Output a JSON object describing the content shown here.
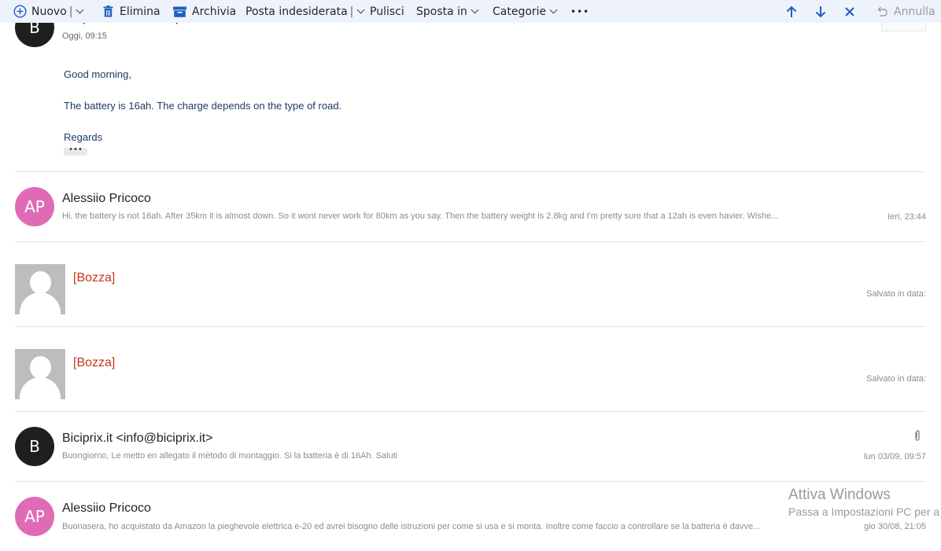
{
  "toolbar": {
    "new_label": "Nuovo",
    "delete_label": "Elimina",
    "archive_label": "Archivia",
    "junk_label": "Posta indesiderata",
    "sweep_label": "Pulisci",
    "move_label": "Sposta in",
    "categories_label": "Categorie",
    "more_label": "•••",
    "undo_label": "Annulla",
    "separator": "|",
    "accent_color": "#1f5fbf"
  },
  "messages": [
    {
      "avatar_initials": "B",
      "sender": "Biciprix.it <info@biciprix.it>",
      "date": "Oggi, 09:15",
      "body": {
        "greeting": "Good morning,",
        "line1": "The battery is 16ah. The charge depends on the type of road.",
        "closing": "Regards",
        "more": "•••"
      }
    },
    {
      "avatar_initials": "AP",
      "sender": "Alessiio Pricoco",
      "preview": "Hi, the battery is not 16ah. After 35km it is almost down. So it wont never work for 80km as you say. Then the battery weight is 2.8kg and I'm pretty sure that a 12ah is even havier. Wishe...",
      "date": "Ieri, 23:44"
    },
    {
      "sender": "[Bozza]",
      "date": "Salvato in data:"
    },
    {
      "sender": "[Bozza]",
      "date": "Salvato in data:"
    },
    {
      "avatar_initials": "B",
      "sender": "Biciprix.it <info@biciprix.it>",
      "preview": "Buongiorno, Le metto en allegato il mètodo di montaggio. Si la batteria è di 16Ah. Saluti",
      "date": "lun 03/09, 09:57",
      "attachment_icon": "paperclip-icon"
    },
    {
      "avatar_initials": "AP",
      "sender": "Alessiio Pricoco",
      "preview": "Buonasera, ho acquistato da Amazon la pieghevole elettrica e-20 ed avrei bisogno delle istruzioni per come si usa e si monta. Inoltre come faccio a controllare se la batteria è davve...",
      "date": "gio 30/08, 21:05"
    }
  ],
  "watermark": {
    "title": "Attiva Windows",
    "subtitle": "Passa a Impostazioni PC per a"
  },
  "colors": {
    "draft_red": "#c6331e",
    "avatar_pink": "#e06bb5",
    "avatar_black": "#1f1f1f"
  }
}
